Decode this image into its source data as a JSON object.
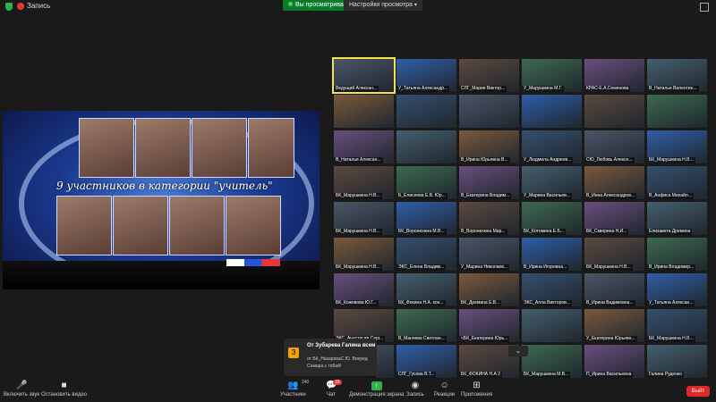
{
  "topbar": {
    "recording_label": "Запись",
    "viewing_label": "Вы просматриваете экран SZD",
    "view_options_label": "Настройки просмотра"
  },
  "shared_screen": {
    "caption": "9 участников в категории \"учитель\""
  },
  "participants": [
    "Ведущий Алексан...",
    "У_Татьяна Александр...",
    "СЛГ_Мария Виктор...",
    "У_Марушкина М.Г.",
    "КРАС-Е.А.Семенова",
    "В_Наталья Валентин...",
    "",
    "",
    "",
    "",
    "",
    "",
    "В_Наталья Алексан...",
    "",
    "В_Ирина Юрьевна В...",
    "У_Людмила Андреев...",
    "СЮ_Любовь Алексе...",
    "БК_Марушкина Н.В...",
    "БК_Марушкина Н.В...",
    "Б_Елисеева Е.В. Юр...",
    "В_Екатерина Владим...",
    "У_Марина Васильев...",
    "В_Инна Александров...",
    "В_Анфиса Михайл...",
    "БК_Марушкина Н.В...",
    "БК_Воронихина М.В...",
    "В_Воронихина Мар...",
    "БК_Котомина Е.Б...",
    "БК_Скворина Н.И...",
    "Елизавета Дремина",
    "БК_Марушкина Н.В...",
    "ЭКС_Елена Владим...",
    "У_Марина Николаев...",
    "В_Ирина Игоревна...",
    "БК_Марушкина Н.В...",
    "В_Ирина Владимир...",
    "БК_Кожевова Ю.Г...",
    "БК_Фокина Н.А. кон...",
    "БК_Дремина Е.В...",
    "ЭКС_Алла Викторов...",
    "В_Ирина Вадимовна...",
    "У_Татьяна Алексан...",
    "ЭКС_Анастасия Серг...",
    "В_Манчева Светлан...",
    "<БК_Екатерина Юрь...",
    "",
    "У_Екатерина Юрьевн...",
    "БК_Марушкина Н.В...",
    "БК_Корзина Ю.Е...",
    "СЛГ_Гусева В.Т...",
    "БК_ФОКИНА Н.А 2",
    "БК_Марушкина М.В...",
    "П_Ирина Васильевна",
    "Галина Руденко"
  ],
  "chat_popup": {
    "avatar_letter": "З",
    "from_label": "От Зубарева Галина всем",
    "message": "от БК_НазароваС.Ю. Вперед Самара с тобой!"
  },
  "toolbar": {
    "mic_label": "Включить звук",
    "video_label": "Остановить видео",
    "participants_count": "240",
    "participants_label": "Участники",
    "chat_badge": "10",
    "chat_label": "Чат",
    "share_label": "Демонстрация экрана",
    "record_label": "Запись",
    "reactions_label": "Реакции",
    "apps_label": "Приложения",
    "leave_label": "Выйт"
  },
  "colors": {
    "accent_green": "#2db34a",
    "leave_red": "#e02828",
    "active_speaker": "#f3e24e"
  }
}
